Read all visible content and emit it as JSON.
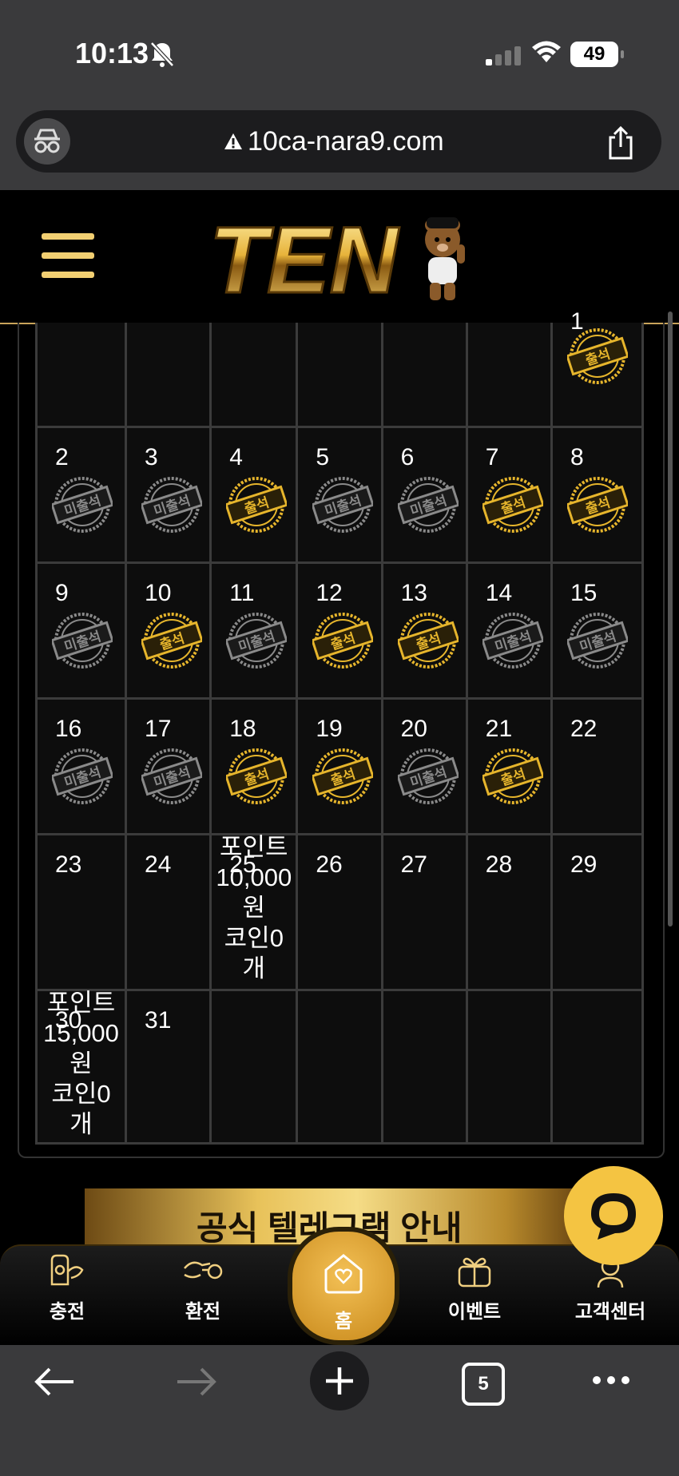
{
  "status": {
    "time": "10:13",
    "battery": "49"
  },
  "browser": {
    "url": "10ca-nara9.com",
    "tab_count": "5"
  },
  "site": {
    "logo_text": "TEN"
  },
  "calendar": {
    "stamp_present": "출석",
    "stamp_absent": "미출석",
    "weeks": [
      [
        {
          "day": "",
          "stamp": ""
        },
        {
          "day": "",
          "stamp": ""
        },
        {
          "day": "",
          "stamp": ""
        },
        {
          "day": "",
          "stamp": ""
        },
        {
          "day": "",
          "stamp": ""
        },
        {
          "day": "",
          "stamp": ""
        },
        {
          "day": "1",
          "stamp": "present"
        }
      ],
      [
        {
          "day": "2",
          "stamp": "absent"
        },
        {
          "day": "3",
          "stamp": "absent"
        },
        {
          "day": "4",
          "stamp": "present"
        },
        {
          "day": "5",
          "stamp": "absent"
        },
        {
          "day": "6",
          "stamp": "absent"
        },
        {
          "day": "7",
          "stamp": "present"
        },
        {
          "day": "8",
          "stamp": "present"
        }
      ],
      [
        {
          "day": "9",
          "stamp": "absent"
        },
        {
          "day": "10",
          "stamp": "present"
        },
        {
          "day": "11",
          "stamp": "absent"
        },
        {
          "day": "12",
          "stamp": "present"
        },
        {
          "day": "13",
          "stamp": "present"
        },
        {
          "day": "14",
          "stamp": "absent"
        },
        {
          "day": "15",
          "stamp": "absent"
        }
      ],
      [
        {
          "day": "16",
          "stamp": "absent"
        },
        {
          "day": "17",
          "stamp": "absent"
        },
        {
          "day": "18",
          "stamp": "present"
        },
        {
          "day": "19",
          "stamp": "present"
        },
        {
          "day": "20",
          "stamp": "absent"
        },
        {
          "day": "21",
          "stamp": "present"
        },
        {
          "day": "22",
          "stamp": ""
        }
      ],
      [
        {
          "day": "23",
          "stamp": ""
        },
        {
          "day": "24",
          "stamp": ""
        },
        {
          "day": "25",
          "stamp": "",
          "reward": [
            "포인트",
            "10,000",
            "원",
            "코인0",
            "개"
          ]
        },
        {
          "day": "26",
          "stamp": ""
        },
        {
          "day": "27",
          "stamp": ""
        },
        {
          "day": "28",
          "stamp": ""
        },
        {
          "day": "29",
          "stamp": ""
        }
      ],
      [
        {
          "day": "30",
          "stamp": "",
          "reward": [
            "포인트",
            "15,000",
            "원",
            "코인0",
            "개"
          ]
        },
        {
          "day": "31",
          "stamp": ""
        },
        {
          "day": "",
          "stamp": ""
        },
        {
          "day": "",
          "stamp": ""
        },
        {
          "day": "",
          "stamp": ""
        },
        {
          "day": "",
          "stamp": ""
        },
        {
          "day": "",
          "stamp": ""
        }
      ]
    ]
  },
  "banner": {
    "text": "공식 텔레그램 안내"
  },
  "nav": {
    "charge": "충전",
    "exchange": "환전",
    "home": "홈",
    "event": "이벤트",
    "support": "고객센터"
  },
  "colors": {
    "gold": "#f4c442",
    "stamp_gold": "#e6b52c",
    "stamp_gray": "#8a8a8a"
  }
}
